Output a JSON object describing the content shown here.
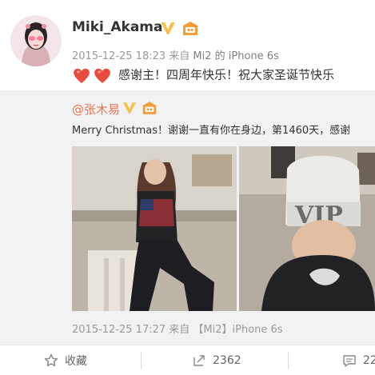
{
  "post": {
    "username": "Miki_Akama",
    "meta_time": "2015-12-25 18:23 来自",
    "meta_source": "Mi2 的 iPhone 6s",
    "content": "感谢主！四周年快乐！祝大家圣诞节快乐"
  },
  "repost": {
    "username": "@张木易",
    "text": "Merry Christmas！谢谢一直有你在身边，第1460天，感谢",
    "meta_time": "2015-12-25 17:27 来自",
    "meta_source": "【Mi2】iPhone 6s",
    "photo_caption": "VIP"
  },
  "actions": {
    "favorite_label": "收藏",
    "repost_count": "2362",
    "comment_count": "22"
  },
  "colors": {
    "username": "#333333",
    "repost_user": "#eb7350",
    "verified_gold": "#f6c14a",
    "hearts": "#e84b3c"
  },
  "icons": [
    "verified-v-icon",
    "rank-badge-icon",
    "heart-emoji-icon",
    "star-icon",
    "repost-icon",
    "comment-icon"
  ]
}
